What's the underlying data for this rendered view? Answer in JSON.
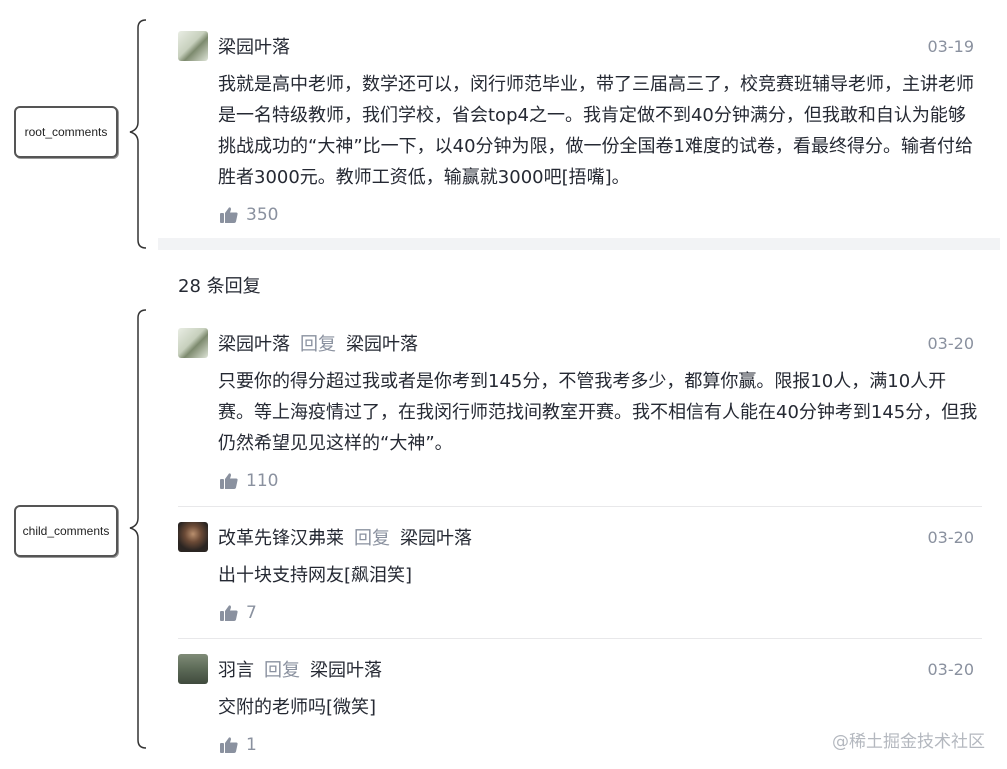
{
  "annotations": {
    "root_label": "root_comments",
    "child_label": "child_comments"
  },
  "root_comment": {
    "author": "梁园叶落",
    "date": "03-19",
    "text": "我就是高中老师，数学还可以，闵行师范毕业，带了三届高三了，校竞赛班辅导老师，主讲老师是一名特级教师，我们学校，省会top4之一。我肯定做不到40分钟满分，但我敢和自认为能够挑战成功的“大神”比一下，以40分钟为限，做一份全国卷1难度的试卷，看最终得分。输者付给胜者3000元。教师工资低，输赢就3000吧[捂嘴]。",
    "likes": "350"
  },
  "reply_count": "28 条回复",
  "replies": [
    {
      "author": "梁园叶落",
      "reply_word": "回复",
      "reply_to": "梁园叶落",
      "date": "03-20",
      "text": "只要你的得分超过我或者是你考到145分，不管我考多少，都算你赢。限报10人，满10人开赛。等上海疫情过了，在我闵行师范找间教室开赛。我不相信有人能在40分钟考到145分，但我仍然希望见见这样的“大神”。",
      "likes": "110"
    },
    {
      "author": "改革先锋汉弗莱",
      "reply_word": "回复",
      "reply_to": "梁园叶落",
      "date": "03-20",
      "text": "出十块支持网友[飙泪笑]",
      "likes": "7"
    },
    {
      "author": "羽言",
      "reply_word": "回复",
      "reply_to": "梁园叶落",
      "date": "03-20",
      "text": "交附的老师吗[微笑]",
      "likes": "1"
    }
  ],
  "watermark": "@稀土掘金技术社区",
  "colors": {
    "text": "#252933",
    "muted": "#8a919f",
    "like_icon": "#8a919f"
  },
  "icons": {
    "like": "thumbs-up-icon"
  }
}
